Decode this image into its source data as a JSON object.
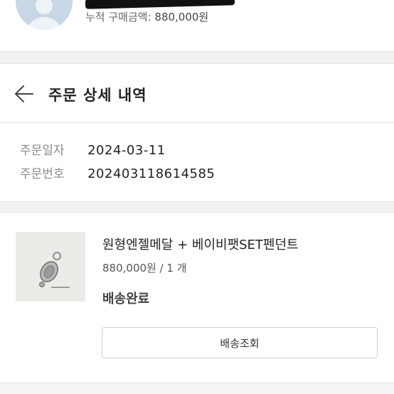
{
  "profile": {
    "total_label": "누적 구매금액:",
    "total_amount": "880,000원"
  },
  "header": {
    "back_icon": "arrow-left-icon",
    "title": "주문 상세 내역"
  },
  "order": {
    "date_label": "주문일자",
    "date_value": "2024-03-11",
    "number_label": "주문번호",
    "number_value": "202403118614585"
  },
  "product": {
    "name": "원형엔젤메달 + 베이비팻SET펜던트",
    "price": "880,000원 / 1 개",
    "status": "배송완료",
    "track_button": "배송조회"
  }
}
